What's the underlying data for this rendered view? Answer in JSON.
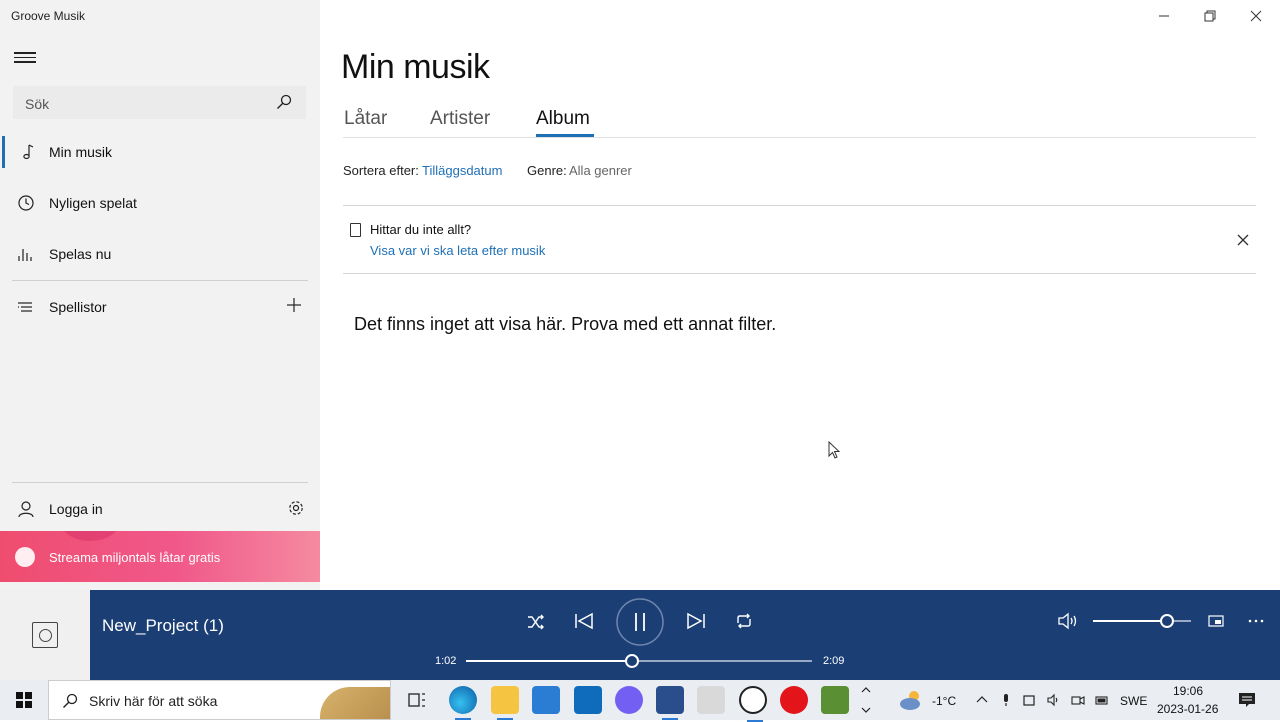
{
  "window": {
    "title": "Groove Musik"
  },
  "sidebar": {
    "search_placeholder": "Sök",
    "items": [
      {
        "label": "Min musik",
        "icon": "music-note-icon",
        "active": true
      },
      {
        "label": "Nyligen spelat",
        "icon": "clock-icon"
      },
      {
        "label": "Spelas nu",
        "icon": "bars-icon"
      },
      {
        "label": "Spellistor",
        "icon": "list-icon"
      }
    ],
    "login_label": "Logga in",
    "promo_label": "Streama miljontals låtar gratis"
  },
  "main": {
    "title": "Min musik",
    "tabs": [
      {
        "label": "Låtar"
      },
      {
        "label": "Artister"
      },
      {
        "label": "Album",
        "active": true
      }
    ],
    "sort_label": "Sortera efter:",
    "sort_value": "Tilläggsdatum",
    "genre_label": "Genre:",
    "genre_value": "Alla genrer",
    "info_title": "Hittar du inte allt?",
    "info_link": "Visa var vi ska leta efter musik",
    "empty_message": "Det finns inget att visa här. Prova med ett annat filter."
  },
  "player": {
    "track_name": "New_Project (1)",
    "elapsed": "1:02",
    "duration": "2:09",
    "progress_fraction": 0.48,
    "volume_fraction": 0.75,
    "accent": "#1b3f75"
  },
  "taskbar": {
    "search_placeholder": "Skriv här för att söka",
    "weather": "-1°C",
    "language": "SWE",
    "time": "19:06",
    "date": "2023-01-26"
  }
}
